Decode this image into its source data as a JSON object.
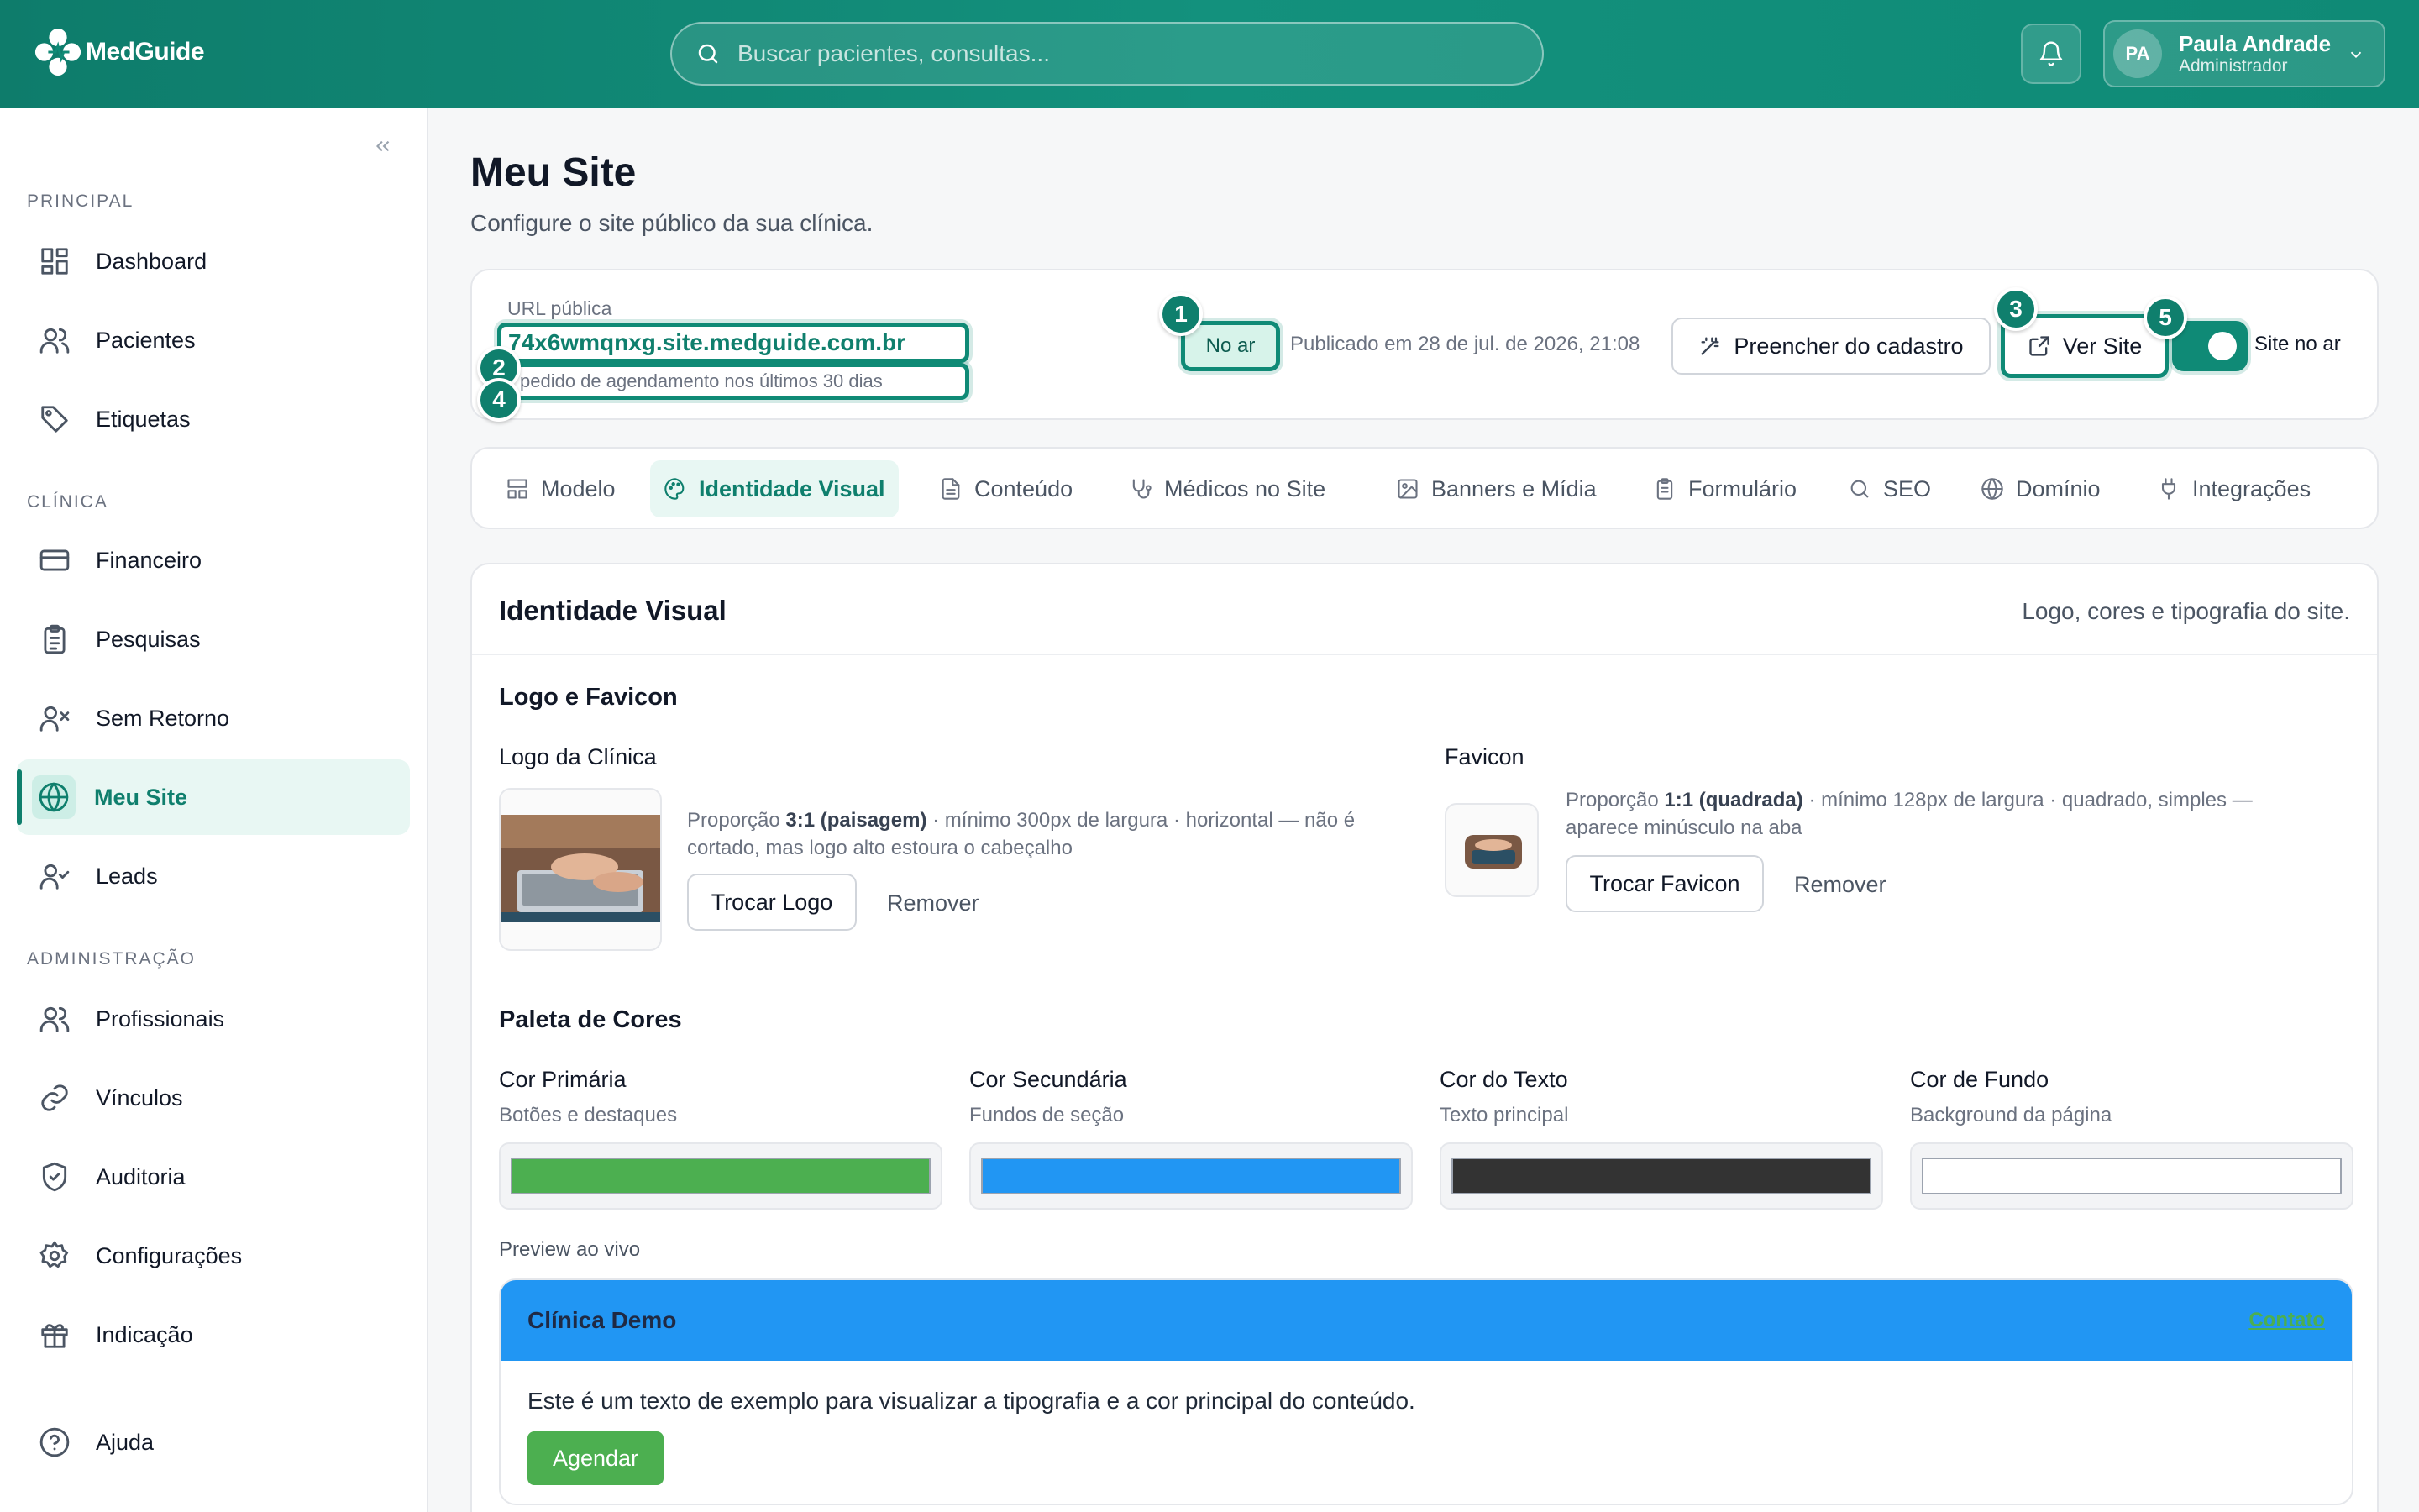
{
  "brand": {
    "name": "MedGuide"
  },
  "search": {
    "placeholder": "Buscar pacientes, consultas..."
  },
  "user": {
    "initials": "PA",
    "name": "Paula Andrade",
    "role": "Administrador"
  },
  "sidebar": {
    "sections": {
      "principal": "PRINCIPAL",
      "clinica": "CLÍNICA",
      "admin": "ADMINISTRAÇÃO"
    },
    "items": {
      "dashboard": "Dashboard",
      "pacientes": "Pacientes",
      "etiquetas": "Etiquetas",
      "financeiro": "Financeiro",
      "pesquisas": "Pesquisas",
      "sem_retorno": "Sem Retorno",
      "meu_site": "Meu Site",
      "leads": "Leads",
      "profissionais": "Profissionais",
      "vinculos": "Vínculos",
      "auditoria": "Auditoria",
      "configuracoes": "Configurações",
      "indicacao": "Indicação",
      "ajuda": "Ajuda"
    }
  },
  "page": {
    "title": "Meu Site",
    "subtitle": "Configure o site público da sua clínica."
  },
  "site": {
    "url_label": "URL pública",
    "url": "74x6wmqnxg.site.medguide.com.br",
    "sub": "pedido de agendamento nos últimos 30 dias",
    "status": "No ar",
    "published": "Publicado em 28 de jul. de 2026, 21:08",
    "fill_button": "Preencher do cadastro",
    "view_button": "Ver Site",
    "toggle_label": "Site no ar",
    "toggle_on": true
  },
  "markers": [
    "1",
    "2",
    "3",
    "4",
    "5"
  ],
  "tabs": [
    "Modelo",
    "Identidade Visual",
    "Conteúdo",
    "Médicos no Site",
    "Banners e Mídia",
    "Formulário",
    "SEO",
    "Domínio",
    "Integrações"
  ],
  "panel": {
    "title": "Identidade Visual",
    "description": "Logo, cores e tipografia do site.",
    "logo_section": "Logo e Favicon",
    "logo": {
      "label": "Logo da Clínica",
      "hint_a": "Proporção ",
      "hint_b": "3:1 (paisagem)",
      "hint_c": " · mínimo 300px de largura · horizontal — não é cortado, mas logo alto estoura o cabeçalho",
      "change": "Trocar Logo",
      "remove": "Remover"
    },
    "favicon": {
      "label": "Favicon",
      "hint_a": "Proporção ",
      "hint_b": "1:1 (quadrada)",
      "hint_c": " · mínimo 128px de largura · quadrado, simples — aparece minúsculo na aba",
      "change": "Trocar Favicon",
      "remove": "Remover"
    },
    "palette_section": "Paleta de Cores",
    "colors": [
      {
        "label": "Cor Primária",
        "sub": "Botões e destaques",
        "value": "#4caf50"
      },
      {
        "label": "Cor Secundária",
        "sub": "Fundos de seção",
        "value": "#2196f3"
      },
      {
        "label": "Cor do Texto",
        "sub": "Texto principal",
        "value": "#333333"
      },
      {
        "label": "Cor de Fundo",
        "sub": "Background da página",
        "value": "#ffffff"
      }
    ],
    "preview": {
      "label": "Preview ao vivo",
      "name": "Clínica Demo",
      "link": "Contato",
      "text": "Este é um texto de exemplo para visualizar a tipografia e a cor principal do conteúdo.",
      "button": "Agendar"
    }
  },
  "theme": {
    "accent": "#0f8a76",
    "accent_dark": "#0f7f6d"
  }
}
